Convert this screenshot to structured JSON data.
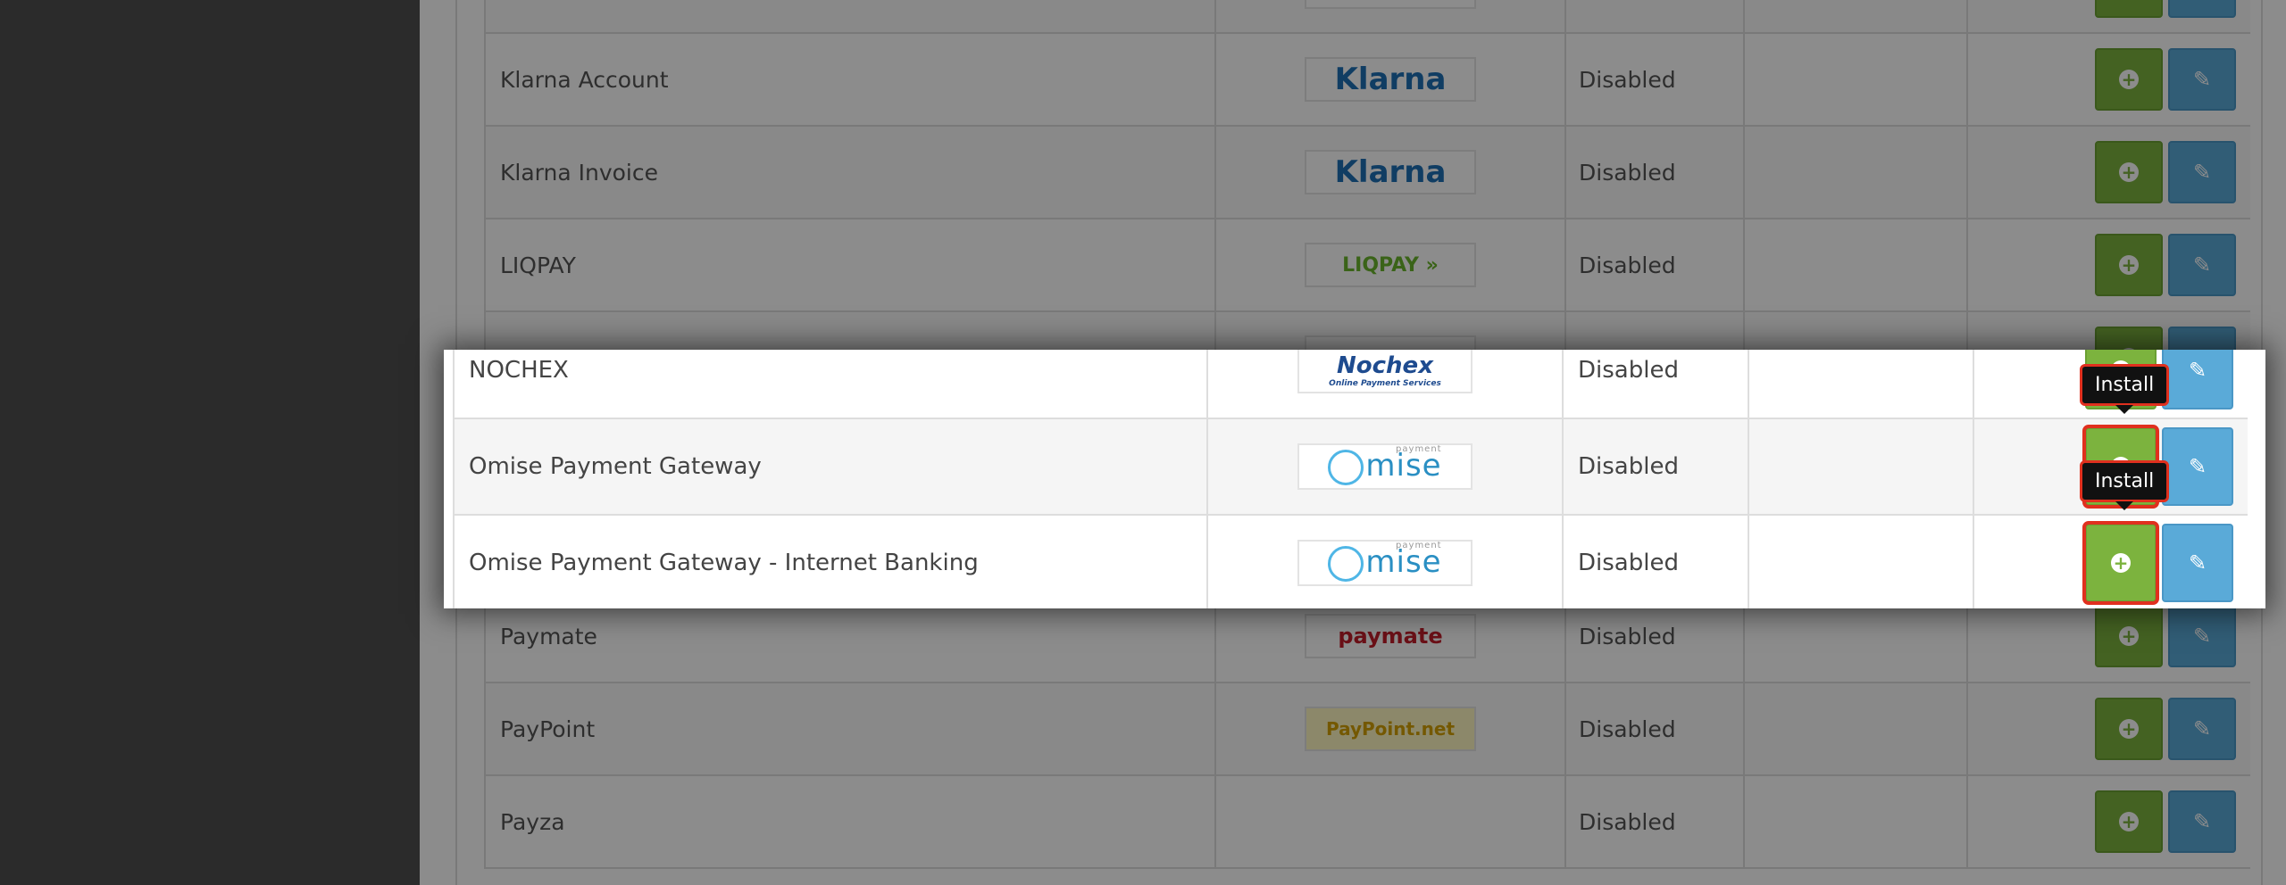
{
  "colors": {
    "install_green": "#7cb33e",
    "edit_blue": "#5aaad8",
    "highlight_red": "#e0301e"
  },
  "background_rows": [
    {
      "name": "",
      "logo": "",
      "logo_color": "#2e8b57",
      "status": ""
    },
    {
      "name": "Klarna Account",
      "logo": "Klarna",
      "logo_color": "#1e6fb5",
      "status": "Disabled"
    },
    {
      "name": "Klarna Invoice",
      "logo": "Klarna",
      "logo_color": "#1e6fb5",
      "status": "Disabled"
    },
    {
      "name": "LIQPAY",
      "logo": "LIQPAY »",
      "logo_color": "#6bb52d",
      "status": "Disabled"
    },
    {
      "name": "",
      "logo": "",
      "logo_color": "#1e4b8f",
      "status": ""
    },
    {
      "name": "",
      "logo": "",
      "logo_color": "#2a8fc3",
      "status": ""
    },
    {
      "name": "",
      "logo": "",
      "logo_color": "#2a8fc3",
      "status": ""
    },
    {
      "name": "Paymate",
      "logo": "paymate",
      "logo_color": "#c41e2a",
      "status": "Disabled"
    },
    {
      "name": "PayPoint",
      "logo": "PayPoint.net",
      "logo_color": "#d4a000",
      "status": "Disabled"
    },
    {
      "name": "Payza",
      "logo": "",
      "logo_color": "#999999",
      "status": "Disabled"
    },
    {
      "name": "",
      "logo": "",
      "logo_color": "#999999",
      "status": ""
    }
  ],
  "zoom_rows": [
    {
      "name": "NOCHEX",
      "logo": "Nochex",
      "logo_sub": "Online Payment Services",
      "status": "Disabled"
    },
    {
      "name": "Omise Payment Gateway",
      "logo": "mise",
      "logo_sub": "payment",
      "status": "Disabled",
      "tooltip": "Install"
    },
    {
      "name": "Omise Payment Gateway - Internet Banking",
      "logo": "mise",
      "logo_sub": "payment",
      "status": "Disabled",
      "tooltip": "Install"
    }
  ],
  "buttons": {
    "install_icon": "plus-circle-icon",
    "edit_icon": "pencil-icon"
  }
}
